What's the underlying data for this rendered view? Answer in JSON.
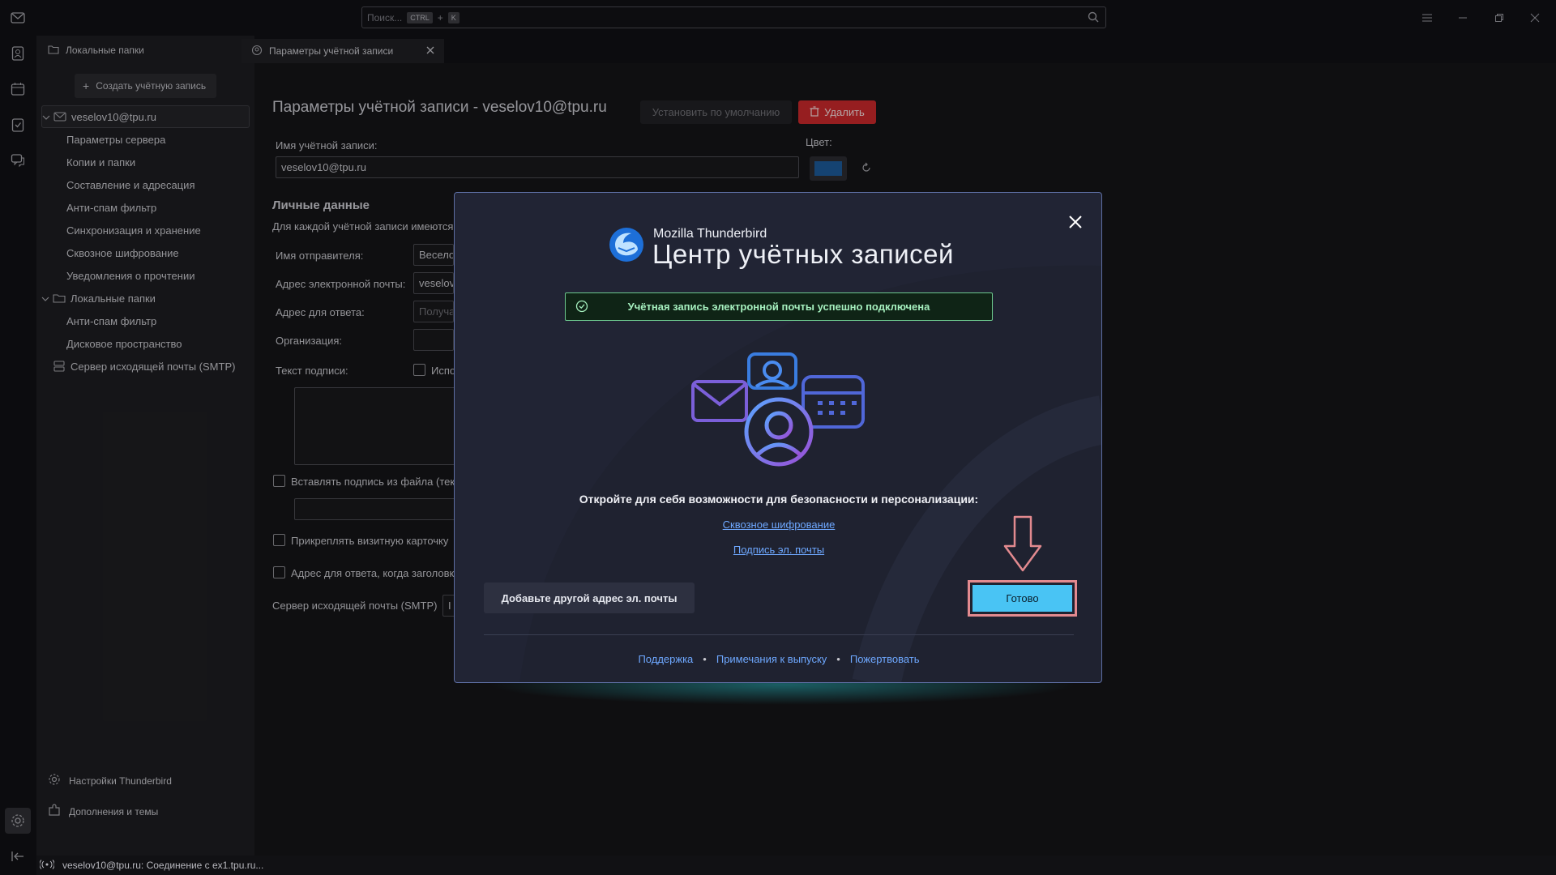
{
  "search": {
    "placeholder": "Поиск...",
    "kbd1": "CTRL",
    "plus": "+",
    "kbd2": "K"
  },
  "folder_pane": {
    "header": "Локальные папки",
    "new_account": "Создать учётную запись",
    "tree": [
      {
        "label": "veselov10@tpu.ru",
        "level": 0,
        "icon": "account-icon",
        "twisty": true,
        "selected": true
      },
      {
        "label": "Параметры сервера",
        "level": 1
      },
      {
        "label": "Копии и папки",
        "level": 1
      },
      {
        "label": "Составление и адресация",
        "level": 1
      },
      {
        "label": "Анти-спам фильтр",
        "level": 1
      },
      {
        "label": "Синхронизация и хранение",
        "level": 1
      },
      {
        "label": "Сквозное шифрование",
        "level": 1
      },
      {
        "label": "Уведомления о прочтении",
        "level": 1
      },
      {
        "label": "Локальные папки",
        "level": 0,
        "icon": "folder-icon",
        "twisty": true
      },
      {
        "label": "Анти-спам фильтр",
        "level": 1
      },
      {
        "label": "Дисковое пространство",
        "level": 1
      },
      {
        "label": "Сервер исходящей почты (SMTP)",
        "level": 0,
        "icon": "server-icon"
      }
    ],
    "settings_label": "Настройки Thunderbird",
    "addons_label": "Дополнения и темы"
  },
  "tab": {
    "label": "Параметры учётной записи"
  },
  "settings": {
    "title": "Параметры учётной записи - veselov10@tpu.ru",
    "set_default": "Установить по умолчанию",
    "delete": "Удалить",
    "account_name_label": "Имя учётной записи:",
    "account_name_value": "veselov10@tpu.ru",
    "color_label": "Цвет:",
    "color_value": "#1d5a99",
    "personal_header": "Личные данные",
    "personal_desc": "Для каждой учётной записи имеются",
    "sender_name_label": "Имя отправителя:",
    "sender_name_value": "Весело",
    "email_label": "Адрес электронной почты:",
    "email_value": "veselov",
    "reply_label": "Адрес для ответа:",
    "reply_placeholder": "Получа",
    "org_label": "Организация:",
    "sig_label": "Текст подписи:",
    "sig_checkbox": "Испо",
    "sig_file": "Вставлять подпись из файла (текс",
    "vcard": "Прикреплять визитную карточку",
    "reply_header": "Адрес для ответа, когда заголовк",
    "smtp_label": "Сервер исходящей почты (SMTP)",
    "smtp_value": "I"
  },
  "dialog": {
    "brand_small": "Mozilla Thunderbird",
    "brand_big": "Центр учётных записей",
    "success": "Учётная запись электронной почты успешно подключена",
    "discover": "Откройте для себя возможности для безопасности и персонализации:",
    "link_e2e": "Сквозное шифрование",
    "link_signature": "Подпись эл. почты",
    "add_another": "Добавьте другой адрес эл. почты",
    "done": "Готово",
    "footer": {
      "support": "Поддержка",
      "release_notes": "Примечания к выпуску",
      "donate": "Пожертвовать"
    }
  },
  "status_bar": {
    "text": "veselov10@tpu.ru: Соединение с ex1.tpu.ru..."
  },
  "colors": {
    "accent": "#49c4f4",
    "delete": "#c8282b",
    "success_border": "#6dc98e",
    "link": "#6ea8ff",
    "highlight": "#e28a8f"
  }
}
